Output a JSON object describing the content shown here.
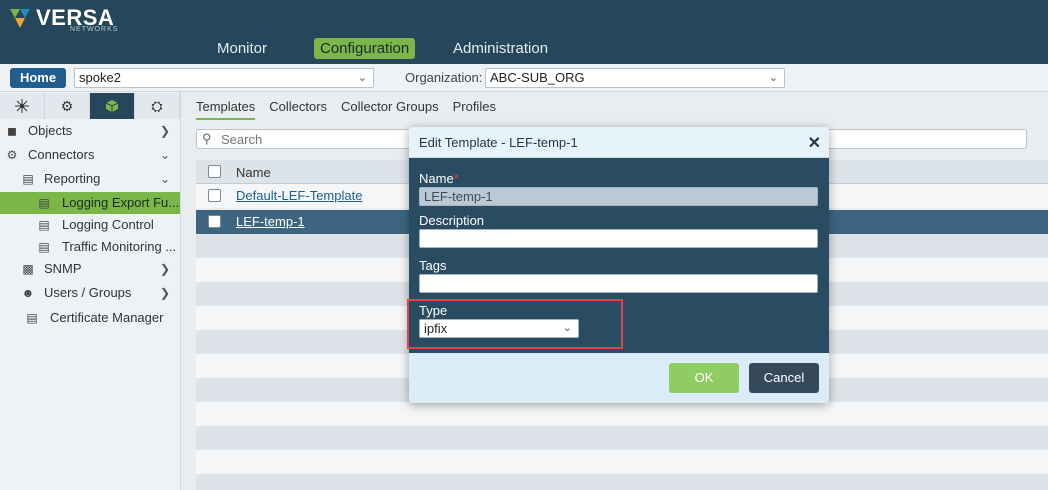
{
  "brand": {
    "name": "VERSA",
    "sub": "NETWORKS"
  },
  "nav": [
    "Monitor",
    "Configuration",
    "Administration"
  ],
  "subbar": {
    "home": "Home",
    "device": "spoke2",
    "org_label": "Organization:",
    "org": "ABC-SUB_ORG"
  },
  "sidebar": {
    "tabs": [
      {
        "icon": "network-icon"
      },
      {
        "icon": "gear-icon"
      },
      {
        "icon": "cube-icon"
      },
      {
        "icon": "settings-globe-icon"
      }
    ],
    "items": [
      {
        "label": "Objects",
        "icon": "cube-icon",
        "arrow": ">"
      },
      {
        "label": "Connectors",
        "icon": "connectors-icon",
        "arrow": "v"
      },
      {
        "label": "Reporting",
        "icon": "chart-icon",
        "arrow": "v"
      },
      {
        "label": "Logging Export Fu...",
        "icon": "document-icon"
      },
      {
        "label": "Logging Control",
        "icon": "document-icon"
      },
      {
        "label": "Traffic Monitoring ...",
        "icon": "document-icon"
      },
      {
        "label": "SNMP",
        "icon": "snmp-icon",
        "arrow": ">"
      },
      {
        "label": "Users / Groups",
        "icon": "user-icon",
        "arrow": ">"
      },
      {
        "label": "Certificate Manager",
        "icon": "certificate-icon"
      }
    ]
  },
  "main": {
    "tabs": [
      "Templates",
      "Collectors",
      "Collector Groups",
      "Profiles"
    ],
    "search_placeholder": "Search",
    "column_name": "Name",
    "rows": [
      "Default-LEF-Template",
      "LEF-temp-1"
    ]
  },
  "modal": {
    "title": "Edit Template - LEF-temp-1",
    "name_label": "Name",
    "name_value": "LEF-temp-1",
    "description_label": "Description",
    "description_value": "",
    "tags_label": "Tags",
    "tags_value": "",
    "type_label": "Type",
    "type_value": "ipfix",
    "ok": "OK",
    "cancel": "Cancel"
  },
  "colors": {
    "header": "#26465b",
    "accent": "#7ab648",
    "modal_body": "#2a4c63",
    "highlight": "#e0434b"
  }
}
